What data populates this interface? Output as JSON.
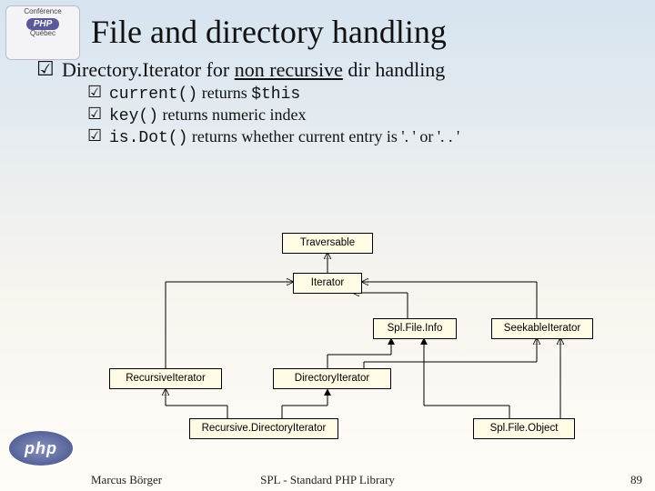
{
  "logos": {
    "conference_line1": "Conférence",
    "conference_badge": "PHP",
    "conference_line2": "Québec",
    "php_badge": "php"
  },
  "title": "File and directory handling",
  "lead": {
    "prefix": "Directory.Iterator for ",
    "underlined": "non recursive",
    "suffix": " dir handling"
  },
  "bullets": [
    {
      "code": "current()",
      "rest": " returns ",
      "code2": "$this",
      "rest2": ""
    },
    {
      "code": "key()",
      "rest": " returns numeric index",
      "code2": "",
      "rest2": ""
    },
    {
      "code": "is.Dot()",
      "rest": " returns whether current entry is '. ' or '. . '",
      "code2": "",
      "rest2": ""
    }
  ],
  "diagram": {
    "nodes": {
      "traversable": "Traversable",
      "iterator": "Iterator",
      "splfileinfo": "Spl.File.Info",
      "seekable": "SeekableIterator",
      "recursiveiter": "RecursiveIterator",
      "diriter": "DirectoryIterator",
      "recdiriter": "Recursive.DirectoryIterator",
      "splfileobject": "Spl.File.Object"
    }
  },
  "footer": {
    "author": "Marcus Börger",
    "mid": "SPL - Standard PHP Library",
    "page": "89"
  }
}
